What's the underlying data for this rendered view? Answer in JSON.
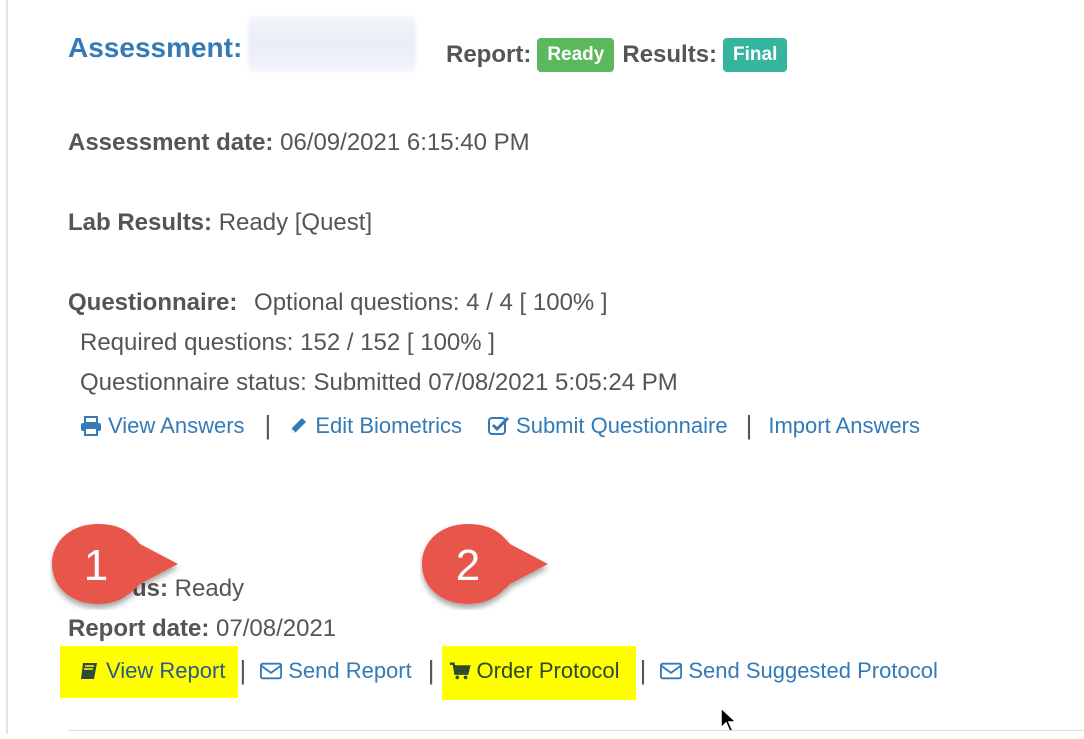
{
  "header": {
    "title": "Assessment:",
    "report_label": "Report:",
    "report_badge": "Ready",
    "results_label": "Results:",
    "results_badge": "Final"
  },
  "details": {
    "assessment_date_label": "Assessment date:",
    "assessment_date_value": "06/09/2021 6:15:40 PM",
    "lab_results_label": "Lab Results:",
    "lab_results_value": "Ready [Quest]",
    "questionnaire_label": "Questionnaire:",
    "optional_questions": "Optional questions: 4 / 4 [ 100% ]",
    "required_questions": "Required questions: 152 / 152 [ 100% ]",
    "questionnaire_status": "Questionnaire status: Submitted 07/08/2021 5:05:24 PM"
  },
  "questionnaire_actions": [
    {
      "label": "View Answers",
      "icon": "print-icon"
    },
    {
      "label": "Edit Biometrics",
      "icon": "pencil-icon"
    },
    {
      "label": "Submit Questionnaire",
      "icon": "check-square-icon"
    },
    {
      "label": "Import Answers",
      "icon": ""
    }
  ],
  "report": {
    "status_label_partial": "us:",
    "status_value": "Ready",
    "date_label": "Report date:",
    "date_value": "07/08/2021"
  },
  "report_actions": [
    {
      "label": "View Report",
      "icon": "book-icon"
    },
    {
      "label": "Send Report",
      "icon": "envelope-icon"
    },
    {
      "label": "Order Protocol",
      "icon": "cart-icon"
    },
    {
      "label": "Send Suggested Protocol",
      "icon": "envelope-icon"
    }
  ],
  "callouts": [
    {
      "number": "1"
    },
    {
      "number": "2"
    }
  ],
  "colors": {
    "link": "#337ab7",
    "badge_ready": "#5cb85c",
    "badge_final": "#35b59d",
    "highlight": "#ffff00",
    "callout": "#e8564b"
  }
}
